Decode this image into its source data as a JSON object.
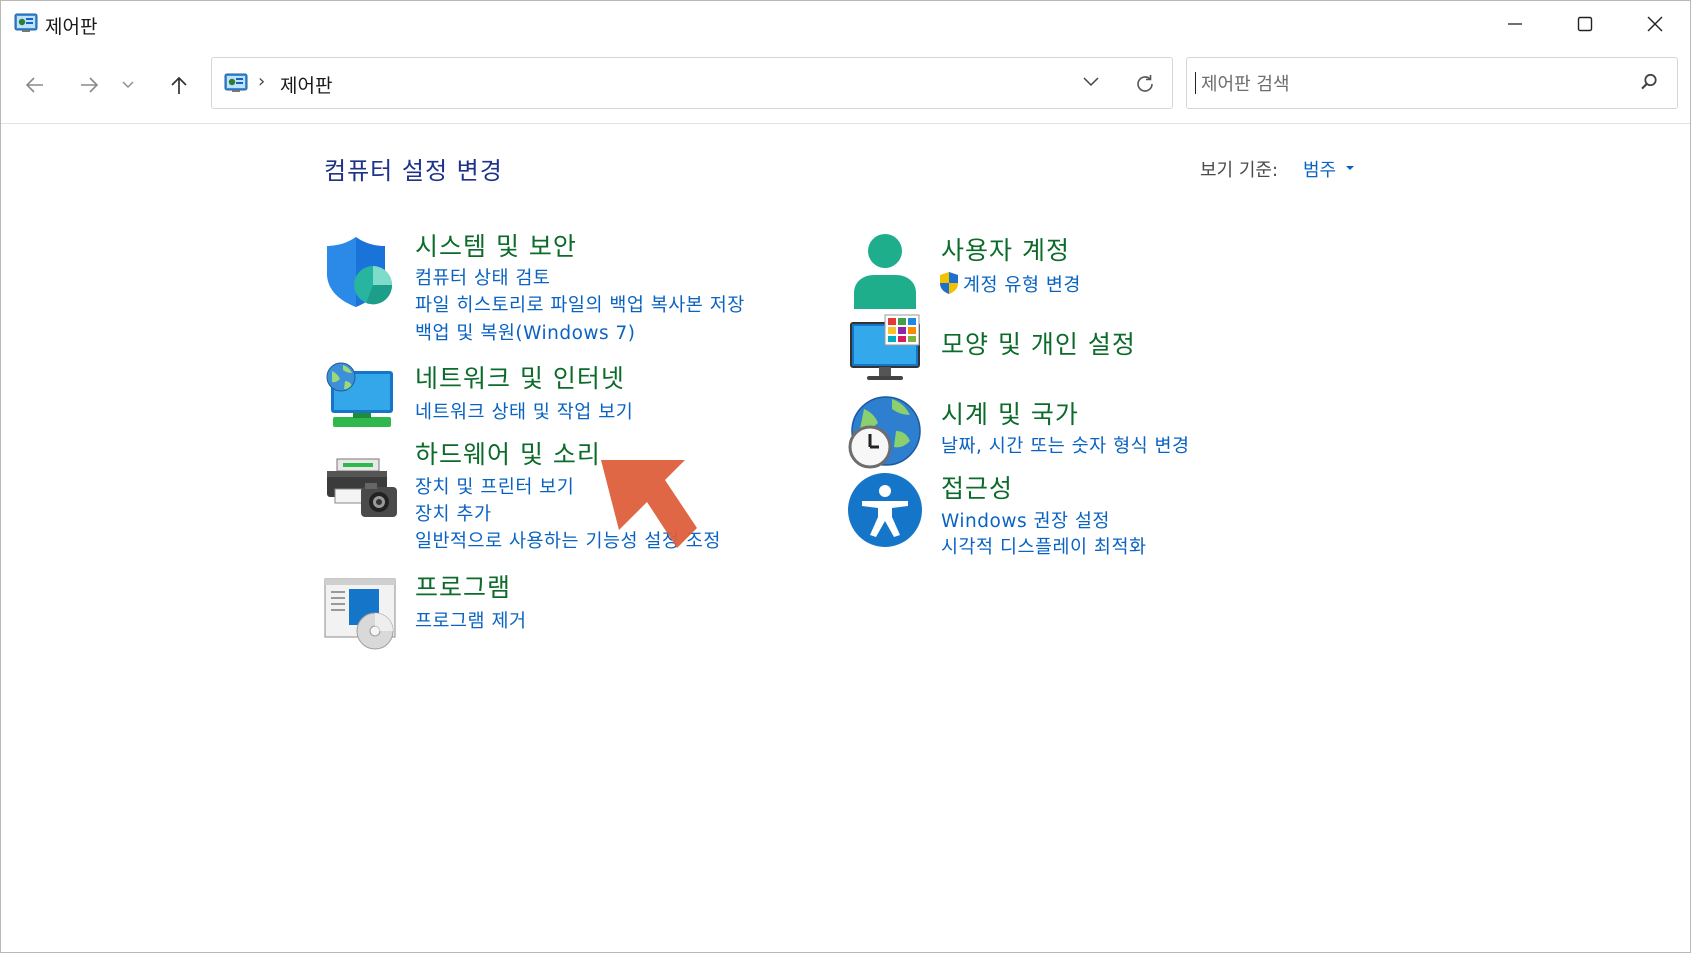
{
  "window": {
    "title": "제어판"
  },
  "navigation": {
    "breadcrumb_separator": "›",
    "address": "제어판",
    "search_placeholder": "제어판 검색"
  },
  "page": {
    "title": "컴퓨터 설정 변경",
    "view_by_label": "보기 기준:",
    "view_by_value": "범주"
  },
  "categories_left": [
    {
      "title": "시스템 및 보안",
      "icon": "security-shield-icon",
      "links": [
        "컴퓨터 상태 검토",
        "파일 히스토리로 파일의 백업 복사본 저장",
        "백업 및 복원(Windows 7)"
      ]
    },
    {
      "title": "네트워크 및 인터넷",
      "icon": "network-globe-icon",
      "links": [
        "네트워크 상태 및 작업 보기"
      ]
    },
    {
      "title": "하드웨어 및 소리",
      "icon": "printer-camera-icon",
      "links": [
        "장치 및 프린터 보기",
        "장치 추가",
        "일반적으로 사용하는 기능성 설정 조정"
      ]
    },
    {
      "title": "프로그램",
      "icon": "programs-disc-icon",
      "links": [
        "프로그램 제거"
      ]
    }
  ],
  "categories_right": [
    {
      "title": "사용자 계정",
      "icon": "user-icon",
      "links": [
        "계정 유형 변경"
      ]
    },
    {
      "title": "모양 및 개인 설정",
      "icon": "monitor-palette-icon",
      "links": []
    },
    {
      "title": "시계 및 국가",
      "icon": "clock-globe-icon",
      "links": [
        "날짜, 시간 또는 숫자 형식 변경"
      ]
    },
    {
      "title": "접근성",
      "icon": "accessibility-icon",
      "links": [
        "Windows 권장 설정",
        "시각적 디스플레이 최적화"
      ]
    }
  ],
  "colors": {
    "title_blue": "#1e3287",
    "category_green": "#0c6b2a",
    "link_blue": "#0a63c2",
    "arrow_annotation": "#dd5f3c"
  }
}
